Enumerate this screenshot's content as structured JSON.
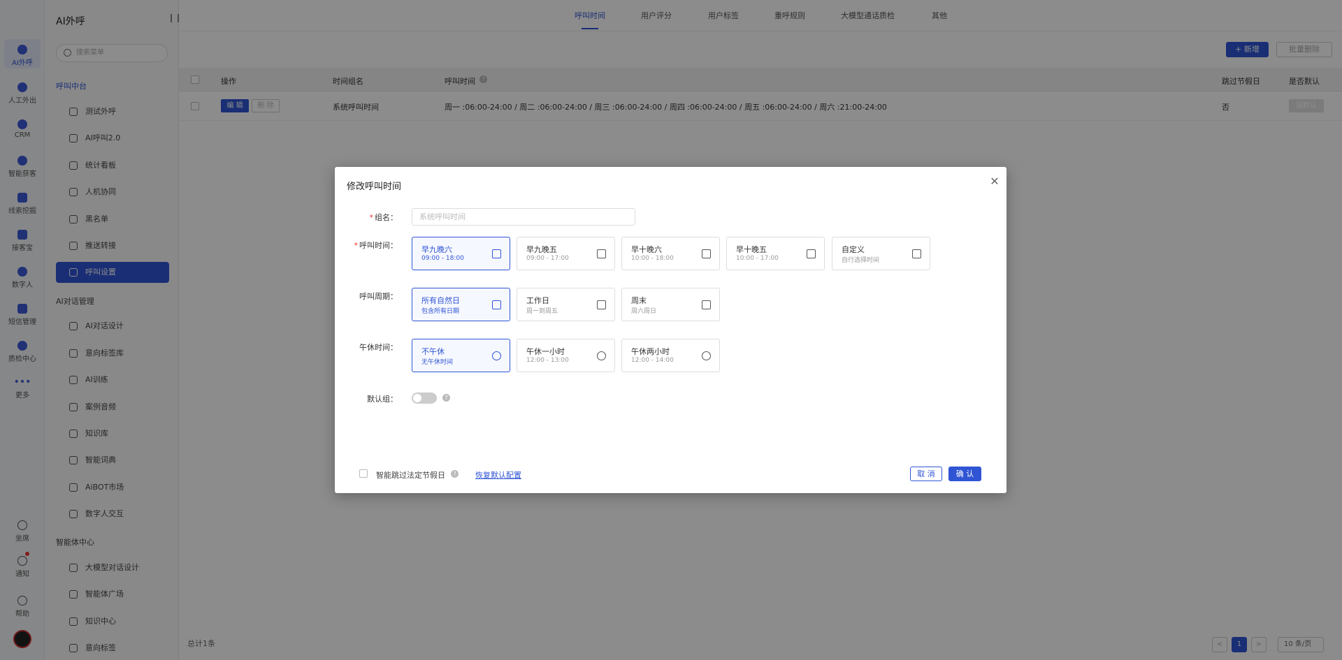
{
  "rail": {
    "items": [
      {
        "label": "AI外呼"
      },
      {
        "label": "人工外出"
      },
      {
        "label": "CRM"
      },
      {
        "label": "智能获客"
      },
      {
        "label": "线索挖掘"
      },
      {
        "label": "接客宝"
      },
      {
        "label": "数字人"
      },
      {
        "label": "短信管理"
      },
      {
        "label": "质检中心"
      },
      {
        "label": "更多"
      }
    ],
    "bottom": [
      {
        "label": "坐席"
      },
      {
        "label": "通知"
      },
      {
        "label": "帮助"
      }
    ]
  },
  "sidebar": {
    "title": "AI外呼",
    "search_placeholder": "搜索菜单",
    "groups": [
      {
        "label": "呼叫中台"
      },
      {
        "label": "AI对话管理"
      },
      {
        "label": "智能体中心"
      }
    ],
    "items": [
      {
        "label": "测试外呼"
      },
      {
        "label": "AI呼叫2.0"
      },
      {
        "label": "统计看板"
      },
      {
        "label": "人机协同"
      },
      {
        "label": "黑名单"
      },
      {
        "label": "推送转接"
      },
      {
        "label": "呼叫设置"
      },
      {
        "label": "AI对话设计"
      },
      {
        "label": "意向标签库"
      },
      {
        "label": "AI训练"
      },
      {
        "label": "案例音频"
      },
      {
        "label": "知识库"
      },
      {
        "label": "智能词典"
      },
      {
        "label": "AiBOT市场"
      },
      {
        "label": "数字人交互"
      },
      {
        "label": "大模型对话设计"
      },
      {
        "label": "智能体广场"
      },
      {
        "label": "知识中心"
      },
      {
        "label": "意向标签"
      }
    ]
  },
  "tabs": [
    {
      "label": "呼叫时间"
    },
    {
      "label": "用户评分"
    },
    {
      "label": "用户标签"
    },
    {
      "label": "重呼规则"
    },
    {
      "label": "大模型通话质检"
    },
    {
      "label": "其他"
    }
  ],
  "toolbar": {
    "add_label": "+ 新增",
    "batch_delete_label": "批量删除"
  },
  "table": {
    "headers": {
      "op": "操作",
      "group_name": "时间组名",
      "call_time": "呼叫时间",
      "skip_holiday": "跳过节假日",
      "is_default": "是否默认"
    },
    "rows": [
      {
        "edit": "编 辑",
        "delete": "删 除",
        "group_name": "系统呼叫时间",
        "call_time": "周一 :06:00-24:00 / 周二 :06:00-24:00 / 周三 :06:00-24:00 / 周四 :06:00-24:00 / 周五 :06:00-24:00 / 周六 :21:00-24:00",
        "skip_holiday": "否",
        "set_default": "设默认"
      }
    ]
  },
  "footer": {
    "total": "总计1条",
    "page": "1",
    "page_size": "10 条/页"
  },
  "modal": {
    "title": "修改呼叫时间",
    "group_name_label": "组名：",
    "group_name_placeholder": "系统呼叫时间",
    "call_time_label": "呼叫时间：",
    "call_time_options": [
      {
        "title": "早九晚六",
        "sub": "09:00 - 18:00",
        "selected": true
      },
      {
        "title": "早九晚五",
        "sub": "09:00 - 17:00",
        "selected": false
      },
      {
        "title": "早十晚六",
        "sub": "10:00 - 18:00",
        "selected": false
      },
      {
        "title": "早十晚五",
        "sub": "10:00 - 17:00",
        "selected": false
      },
      {
        "title": "自定义",
        "sub": "自行选择时间",
        "selected": false
      }
    ],
    "period_label": "呼叫周期：",
    "period_options": [
      {
        "title": "所有自然日",
        "sub": "包含所有日期",
        "selected": true
      },
      {
        "title": "工作日",
        "sub": "周一到周五",
        "selected": false
      },
      {
        "title": "周末",
        "sub": "周六周日",
        "selected": false
      }
    ],
    "lunch_label": "午休时间：",
    "lunch_options": [
      {
        "title": "不午休",
        "sub": "无午休时间",
        "selected": true
      },
      {
        "title": "午休一小时",
        "sub": "12:00 - 13:00",
        "selected": false
      },
      {
        "title": "午休两小时",
        "sub": "12:00 - 14:00",
        "selected": false
      }
    ],
    "default_label": "默认组：",
    "default_on": false,
    "skip_holiday_text": "智能跳过法定节假日",
    "restore_link": "恢复默认配置",
    "cancel": "取 消",
    "confirm": "确 认"
  },
  "colors": {
    "accent": "#2f55d4",
    "overlay": "rgba(0,0,0,0.45)"
  }
}
